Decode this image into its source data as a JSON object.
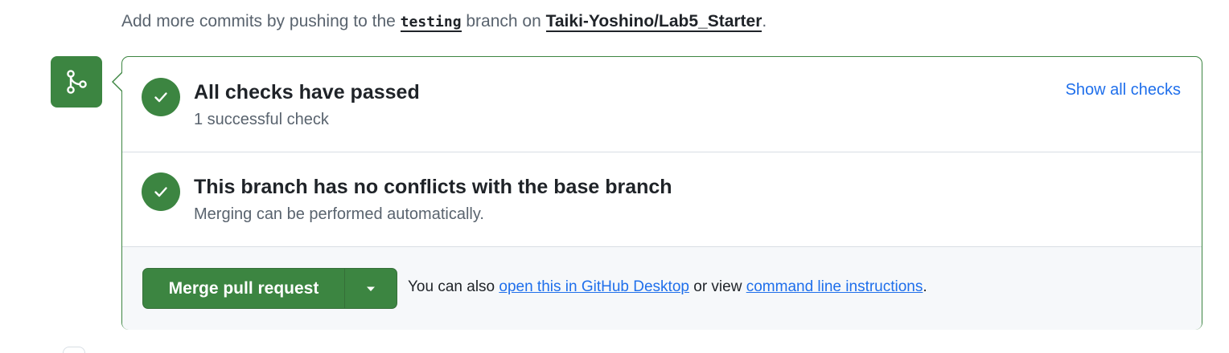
{
  "hint": {
    "prefix": "Add more commits by pushing to the ",
    "branch": "testing",
    "middle": " branch on ",
    "repo": "Taiki-Yoshino/Lab5_Starter",
    "suffix": "."
  },
  "checks": {
    "title": "All checks have passed",
    "subtitle": "1 successful check",
    "show_all_label": "Show all checks"
  },
  "conflicts": {
    "title": "This branch has no conflicts with the base branch",
    "subtitle": "Merging can be performed automatically."
  },
  "merge": {
    "button_label": "Merge pull request",
    "also_prefix": "You can also ",
    "desktop_link": "open this in GitHub Desktop",
    "also_middle": " or view ",
    "cli_link": "command line instructions",
    "also_suffix": "."
  },
  "colors": {
    "success": "#3c8541",
    "link": "#1f6feb",
    "muted": "#59636e"
  },
  "icons": {
    "badge": "git-merge-icon",
    "check": "check-icon",
    "caret": "triangle-down-icon"
  }
}
